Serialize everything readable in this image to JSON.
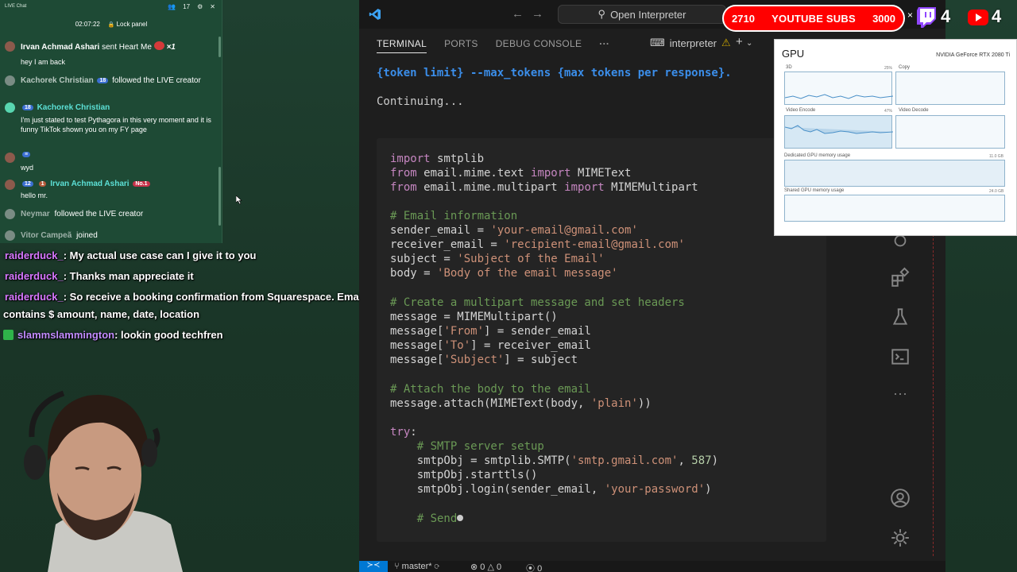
{
  "chat_panel": {
    "title": "LIVE Chat",
    "viewer_count": "17",
    "timer": "02:07:22",
    "lock_label": "Lock panel",
    "gift_row": {
      "user": "Irvan Achmad Ashari",
      "text": "sent Heart Me",
      "multiplier": "×1"
    },
    "messages": [
      {
        "kind": "partial",
        "text": "hey I am back"
      },
      {
        "kind": "event",
        "user": "Kachorek Christian",
        "badge": "18",
        "text": "followed the LIVE creator"
      },
      {
        "kind": "chat",
        "user": "Kachorek Christian",
        "badge": "18",
        "text": "I'm just stated to test Pythagora in this very moment and it is funny TikTok shown you on my FY page"
      },
      {
        "kind": "chat",
        "user": "",
        "badge": "≡",
        "text": "wyd"
      },
      {
        "kind": "chat",
        "user": "Irvan Achmad Ashari",
        "badge": "12",
        "badge2": "1",
        "badge3": "No.1",
        "text": "hello mr."
      },
      {
        "kind": "event",
        "user": "Neymar",
        "text": "followed the LIVE creator"
      },
      {
        "kind": "event",
        "user": "Vitor Campeã",
        "text": "joined"
      }
    ]
  },
  "overlay_chat": [
    {
      "user": "raiderduck_",
      "text": ": My actual use case can I give it to you"
    },
    {
      "user": "raiderduck_",
      "text": ": Thanks man appreciate it"
    },
    {
      "user": "raiderduck_",
      "text": ": So receive a booking confirmation from Squarespace. Email"
    },
    {
      "user": "",
      "text": "contains $ amount, name, date, location"
    },
    {
      "user": "slammslammington",
      "text": ": lookin good techfren"
    }
  ],
  "vscode": {
    "command_center": "Open Interpreter",
    "panel_tabs": [
      "TERMINAL",
      "PORTS",
      "DEBUG CONSOLE",
      "···"
    ],
    "terminal_name": "interpreter",
    "terminal_lines": {
      "token_hint": "{token limit} --max_tokens {max tokens per response}.",
      "continuing": "Continuing..."
    },
    "code_lines": [
      "import smtplib",
      "from email.mime.text import MIMEText",
      "from email.mime.multipart import MIMEMultipart",
      "",
      "# Email information",
      "sender_email = 'your-email@gmail.com'",
      "receiver_email = 'recipient-email@gmail.com'",
      "subject = 'Subject of the Email'",
      "body = 'Body of the email message'",
      "",
      "# Create a multipart message and set headers",
      "message = MIMEMultipart()",
      "message['From'] = sender_email",
      "message['To'] = receiver_email",
      "message['Subject'] = subject",
      "",
      "# Attach the body to the email",
      "message.attach(MIMEText(body, 'plain'))",
      "",
      "try:",
      "    # SMTP server setup",
      "    smtpObj = smtplib.SMTP('smtp.gmail.com', 587)",
      "    smtpObj.starttls()",
      "    smtpObj.login(sender_email, 'your-password')",
      "",
      "    # Send"
    ],
    "status": {
      "branch": "master*",
      "errors": "0",
      "warnings": "0",
      "ports": "0"
    }
  },
  "gpu_widget": {
    "title": "GPU",
    "model": "NVIDIA GeForce RTX 2080 Ti",
    "graphs": [
      {
        "label": "3D",
        "pct": "25%"
      },
      {
        "label": "Copy",
        "pct": ""
      },
      {
        "label": "Video Encode",
        "pct": "47%"
      },
      {
        "label": "Video Decode",
        "pct": ""
      }
    ],
    "dedicated_label": "Dedicated GPU memory usage",
    "dedicated_max": "11.0 GB",
    "shared_label": "Shared GPU memory usage",
    "shared_max": "24.0 GB"
  },
  "stream_overlay": {
    "current_subs": "2710",
    "subs_label": "YOUTUBE SUBS",
    "goal_subs": "3000",
    "close": "×",
    "twitch_viewers": "4",
    "youtube_viewers": "4"
  },
  "colors": {
    "chat_bg": "#1e4a35",
    "terminal_bg": "#1e1e1e",
    "subs_pill": "#ff0000",
    "overlay_user": "#d777ff"
  }
}
